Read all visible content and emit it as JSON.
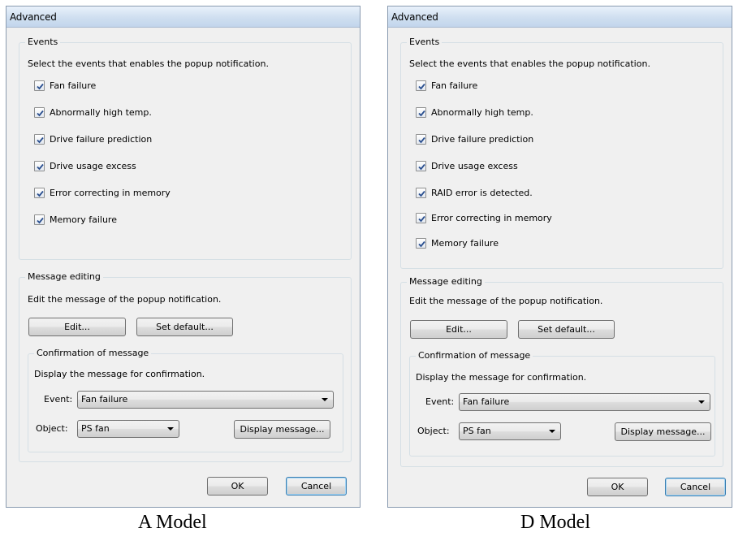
{
  "dialogs": [
    {
      "title": "Advanced",
      "events_group": {
        "legend": "Events",
        "description": "Select the events that enables the popup notification.",
        "items": [
          {
            "label": "Fan failure",
            "checked": true
          },
          {
            "label": "Abnormally high temp.",
            "checked": true
          },
          {
            "label": "Drive failure prediction",
            "checked": true
          },
          {
            "label": "Drive usage excess",
            "checked": true
          },
          {
            "label": "Error correcting in memory",
            "checked": true
          },
          {
            "label": "Memory failure",
            "checked": true
          }
        ]
      },
      "message_group": {
        "legend": "Message editing",
        "description": "Edit the message of the popup notification.",
        "edit_label": "Edit...",
        "set_default_label": "Set default...",
        "confirmation": {
          "legend": "Confirmation of message",
          "description": "Display the message for confirmation.",
          "event_label": "Event:",
          "event_value": "Fan failure",
          "object_label": "Object:",
          "object_value": "PS fan",
          "display_message_label": "Display message..."
        }
      },
      "ok_label": "OK",
      "cancel_label": "Cancel",
      "caption": "A Model"
    },
    {
      "title": "Advanced",
      "events_group": {
        "legend": "Events",
        "description": "Select the events that enables the popup notification.",
        "items": [
          {
            "label": "Fan failure",
            "checked": true
          },
          {
            "label": "Abnormally high temp.",
            "checked": true
          },
          {
            "label": "Drive failure prediction",
            "checked": true
          },
          {
            "label": "Drive usage excess",
            "checked": true
          },
          {
            "label": "RAID error is detected.",
            "checked": true
          },
          {
            "label": "Error correcting in memory",
            "checked": true
          },
          {
            "label": "Memory failure",
            "checked": true
          }
        ]
      },
      "message_group": {
        "legend": "Message editing",
        "description": "Edit the message of the popup notification.",
        "edit_label": "Edit...",
        "set_default_label": "Set default...",
        "confirmation": {
          "legend": "Confirmation of message",
          "description": "Display the message for confirmation.",
          "event_label": "Event:",
          "event_value": "Fan failure",
          "object_label": "Object:",
          "object_value": "PS fan",
          "display_message_label": "Display message..."
        }
      },
      "ok_label": "OK",
      "cancel_label": "Cancel",
      "caption": "D Model"
    }
  ]
}
